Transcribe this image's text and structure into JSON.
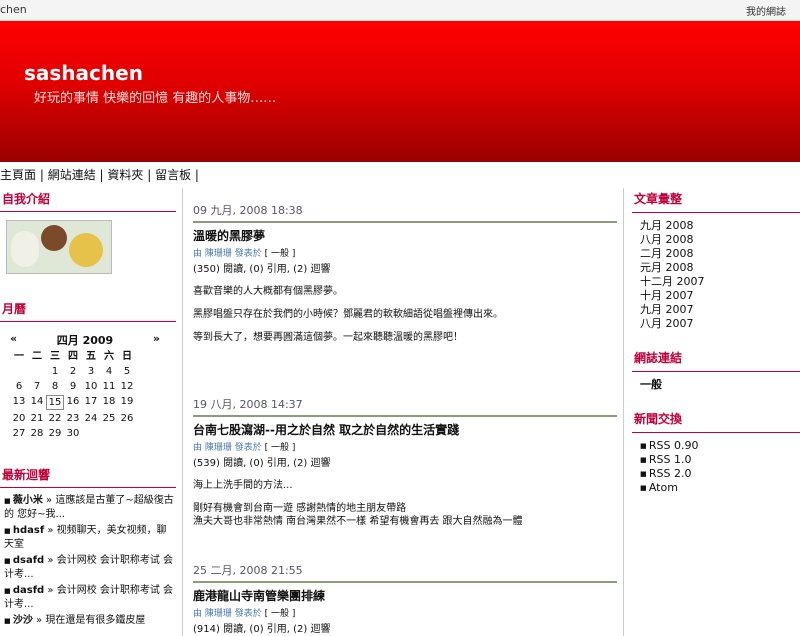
{
  "topbar": {
    "left_text": "chen",
    "right_text": "我的網誌"
  },
  "banner": {
    "title": "sashachen",
    "subtitle": "好玩的事情 快樂的回憶 有趣的人事物……"
  },
  "nav": {
    "items": [
      "主頁面 |",
      "網站連結 |",
      "資料夾 |",
      "留言板 |"
    ]
  },
  "left": {
    "intro_title": "自我介紹",
    "calendar_title": "月曆",
    "calendar": {
      "prev": "«",
      "month": "四月 2009",
      "next": "»",
      "dow": [
        "一",
        "二",
        "三",
        "四",
        "五",
        "六",
        "日"
      ],
      "rows": [
        [
          "",
          "",
          "1",
          "2",
          "3",
          "4",
          "5"
        ],
        [
          "6",
          "7",
          "8",
          "9",
          "10",
          "11",
          "12"
        ],
        [
          "13",
          "14",
          "15",
          "16",
          "17",
          "18",
          "19"
        ],
        [
          "20",
          "21",
          "22",
          "23",
          "24",
          "25",
          "26"
        ],
        [
          "27",
          "28",
          "29",
          "30",
          "",
          "",
          ""
        ]
      ],
      "today": "15"
    },
    "comments_title": "最新迴響",
    "comments": [
      {
        "who": "薇小米",
        "text": " » 這應該是古董了~超級復古的 您好~我..."
      },
      {
        "who": "hdasf",
        "text": " » 视频聊天，美女视频，聊天室"
      },
      {
        "who": "dsafd",
        "text": " » 会计网校 会计职称考试 会计考..."
      },
      {
        "who": "dasfd",
        "text": " » 会计网校 会计职称考试 会计考..."
      },
      {
        "who": "沙沙",
        "text": " » 現在還是有很多鐵皮屋"
      }
    ]
  },
  "posts": [
    {
      "date": "09 九月, 2008 18:38",
      "title": "溫暖的黑膠夢",
      "byline": "由 陳珊珊 發表於",
      "tag": "[ 一般 ]",
      "stats": "(350) 閱讀, (0) 引用, (2) 迴響",
      "body": [
        "喜歡音樂的人大概都有個黑膠夢。",
        "黑膠唱盤只存在於我們的小時候？鄧麗君的軟軟細語從唱盤裡傳出來。",
        "等到長大了，想要再圓滿這個夢。一起來聽聽溫暖的黑膠吧！"
      ]
    },
    {
      "date": "19 八月, 2008 14:37",
      "title": "台南七股瀉湖--用之於自然 取之於自然的生活實踐",
      "byline": "由 陳珊珊 發表於",
      "tag": "[ 一般 ]",
      "stats": "(539) 閱讀, (0) 引用, (2) 迴響",
      "body": [
        "海上上洗手間的方法...",
        "剛好有機會到台南一遊 感謝熱情的地主朋友帶路\n漁夫大哥也非常熱情 南台灣果然不一樣 希望有機會再去 跟大自然融為一體"
      ]
    },
    {
      "date": "25 二月, 2008 21:55",
      "title": "鹿港龍山寺南管樂團排練",
      "byline": "由 陳珊珊 發表於",
      "tag": "[ 一般 ]",
      "stats": "(914) 閱讀, (0) 引用, (2) 迴響",
      "body": []
    }
  ],
  "right": {
    "archive_title": "文章彙整",
    "archive": [
      "九月 2008",
      "八月 2008",
      "二月 2008",
      "元月 2008",
      "十二月 2007",
      "十月 2007",
      "九月 2007",
      "八月 2007"
    ],
    "links_title": "網誌連結",
    "links": [
      "一般"
    ],
    "feeds_title": "新聞交換",
    "feeds": [
      "RSS 0.90",
      "RSS 1.0",
      "RSS 2.0",
      "Atom"
    ]
  }
}
